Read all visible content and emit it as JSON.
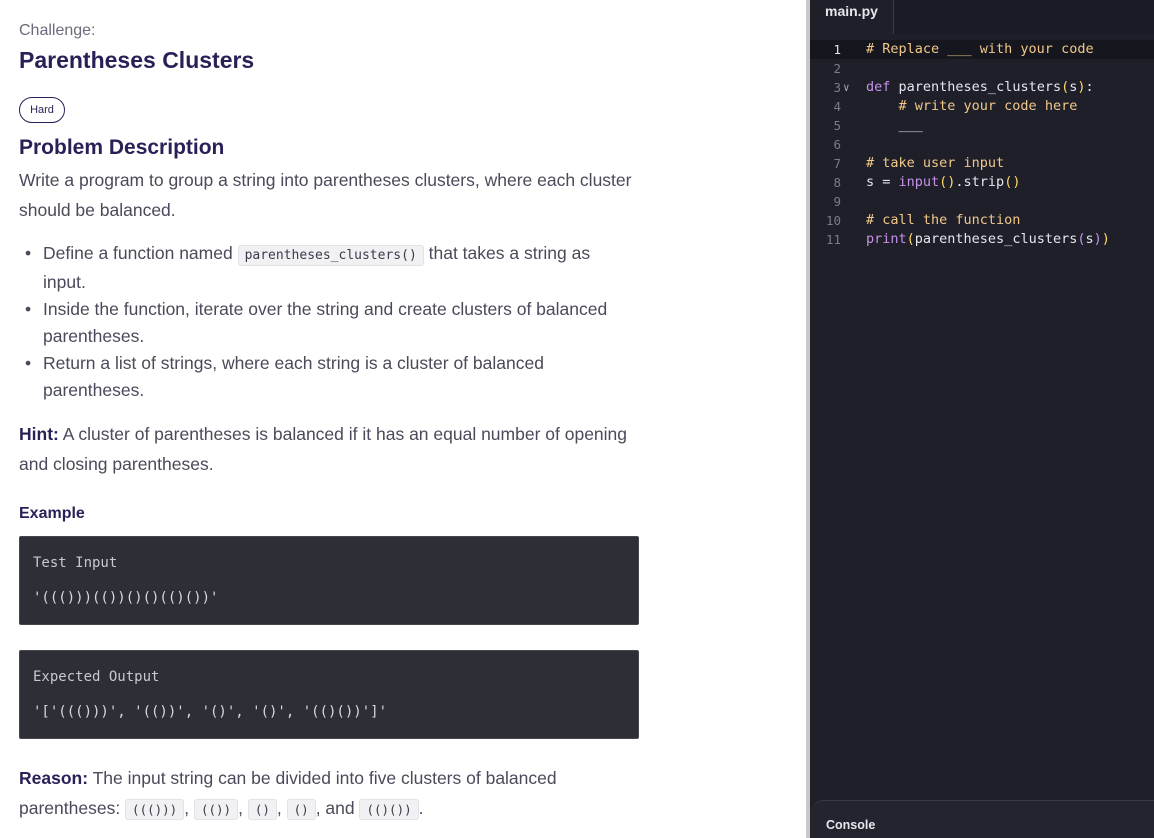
{
  "challenge": {
    "label": "Challenge:",
    "title": "Parentheses Clusters",
    "difficulty": "Hard"
  },
  "description": {
    "heading": "Problem Description",
    "text": "Write a program to group a string into parentheses clusters, where each cluster should be balanced.",
    "bullets": [
      {
        "pre": "Define a function named ",
        "code": "parentheses_clusters()",
        "post": " that takes a string as input."
      },
      {
        "pre": "Inside the function, iterate over the string and create clusters of balanced parentheses.",
        "code": "",
        "post": ""
      },
      {
        "pre": "Return a list of strings, where each string is a cluster of balanced parentheses.",
        "code": "",
        "post": ""
      }
    ],
    "hint_label": "Hint:",
    "hint_text": " A cluster of parentheses is balanced if it has an equal number of opening and closing parentheses."
  },
  "example": {
    "label": "Example",
    "input_label": "Test Input",
    "input_value": "'((()))(())()()(()())'",
    "output_label": "Expected Output",
    "output_value": "'['((()))', '(())', '()', '()', '(()())']'"
  },
  "reason": {
    "label": "Reason:",
    "text": " The input string can be divided into five clusters of balanced parentheses: ",
    "chips": [
      "((()))",
      "(())",
      "()",
      "()",
      "(()())"
    ],
    "sep": ",",
    "and": ", and ",
    "end": "."
  },
  "editor": {
    "tab": "main.py",
    "lines": [
      {
        "n": "1",
        "html": "<span class='cm'># Replace ___ with your code</span>",
        "active": true
      },
      {
        "n": "2",
        "html": "",
        "active": false
      },
      {
        "n": "3",
        "html": "<span class='kw'>def</span> <span class='fn'>parentheses_clusters</span><span class='pr'>(</span>s<span class='pr'>)</span>:",
        "fold": true,
        "active": false
      },
      {
        "n": "4",
        "html": "    <span class='cm'># write your code here</span>",
        "active": false
      },
      {
        "n": "5",
        "html": "    ___",
        "active": false
      },
      {
        "n": "6",
        "html": "",
        "active": false
      },
      {
        "n": "7",
        "html": "<span class='cm'># take user input</span>",
        "active": false
      },
      {
        "n": "8",
        "html": "s = <span class='bi'>input</span><span class='pr'>()</span>.strip<span class='pr'>()</span>",
        "active": false
      },
      {
        "n": "9",
        "html": "",
        "active": false
      },
      {
        "n": "10",
        "html": "<span class='cm'># call the function</span>",
        "active": false
      },
      {
        "n": "11",
        "html": "<span class='bi'>print</span><span class='pr'>(</span>parentheses_clusters<span class='kw'>(</span>s<span class='kw'>)</span><span class='pr'>)</span>",
        "active": false
      }
    ]
  },
  "console": {
    "label": "Console"
  }
}
